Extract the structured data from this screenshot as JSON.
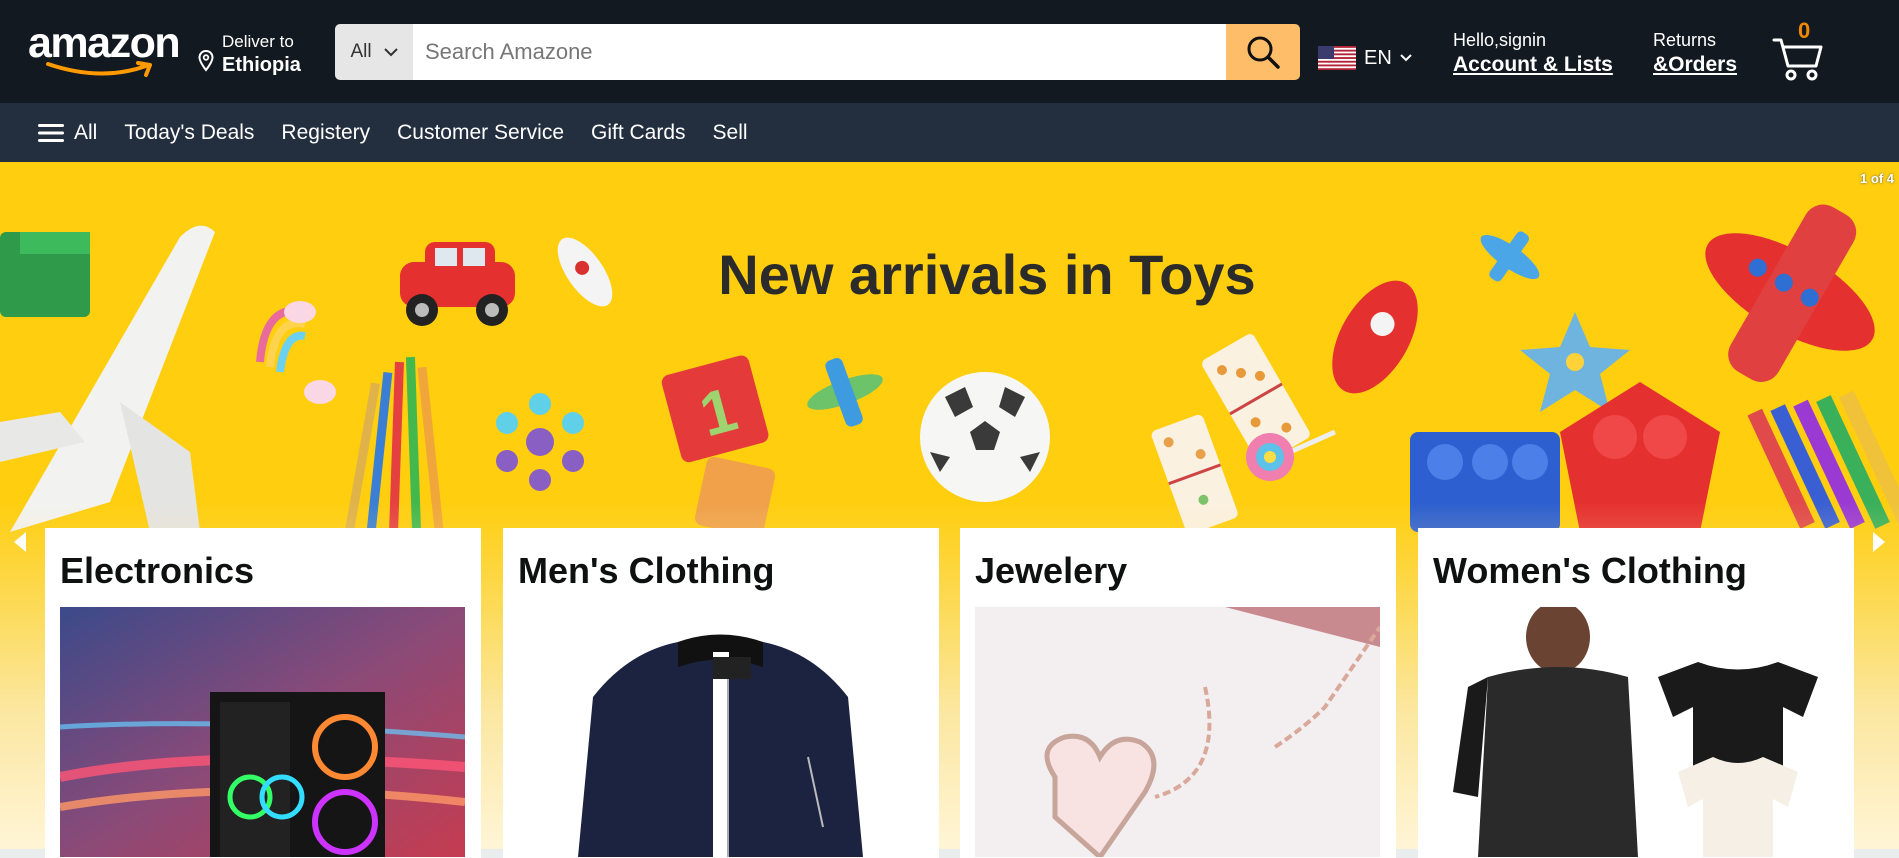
{
  "header": {
    "logo_text": "amazon",
    "deliver_label": "Deliver to",
    "deliver_location": "Ethiopia",
    "search": {
      "category": "All",
      "placeholder": "Search Amazone"
    },
    "language": "EN",
    "account_line1": "Hello,signin",
    "account_line2": "Account & Lists",
    "orders_line1": "Returns",
    "orders_line2": "&Orders",
    "cart_count": "0"
  },
  "subnav": {
    "items": [
      "All",
      "Today's Deals",
      "Registery",
      "Customer Service",
      "Gift Cards",
      "Sell"
    ]
  },
  "hero": {
    "title": "New arrivals in Toys",
    "slide_indicator": "1 of 4"
  },
  "cards": [
    {
      "title": "Electronics"
    },
    {
      "title": "Men's Clothing"
    },
    {
      "title": "Jewelery"
    },
    {
      "title": "Women's Clothing"
    }
  ],
  "colors": {
    "nav_dark": "#131921",
    "subnav": "#232f3e",
    "search_button": "#febd69",
    "hero_yellow": "#fece0f",
    "cart_count": "#f08804"
  },
  "icons": [
    "location-pin-icon",
    "chevron-down-icon",
    "search-icon",
    "us-flag-icon",
    "cart-icon",
    "hamburger-icon",
    "arrow-left-icon",
    "arrow-right-icon"
  ]
}
